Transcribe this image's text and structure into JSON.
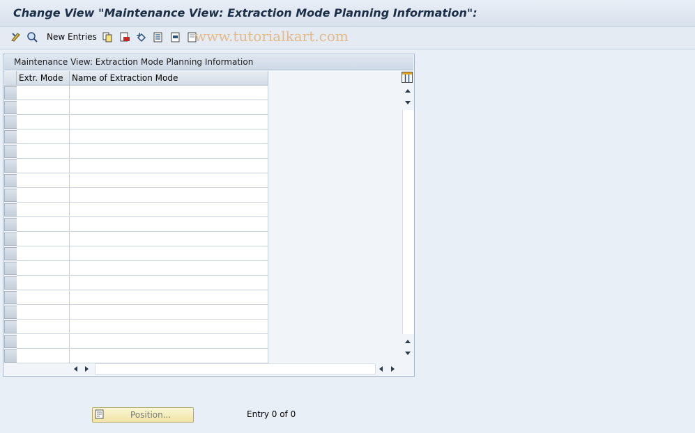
{
  "title": "Change View \"Maintenance View: Extraction Mode Planning Information\":",
  "toolbar": {
    "new_entries_label": "New Entries",
    "watermark": "www.tutorialkart.com",
    "icons": [
      "display-change-icon",
      "find-icon",
      "copy-icon",
      "delete-icon",
      "undo-icon",
      "select-all-icon",
      "select-block-icon",
      "deselect-all-icon"
    ]
  },
  "table": {
    "title": "Maintenance View: Extraction Mode Planning Information",
    "columns": [
      "Extr. Mode",
      "Name of Extraction Mode"
    ],
    "rows": 19
  },
  "footer": {
    "position_label": "Position...",
    "entry_text": "Entry 0 of 0"
  },
  "colors": {
    "background": "#e9eff6",
    "title_text": "#1b2d47",
    "watermark": "#e3b98e",
    "position_button": "#efe4a4"
  }
}
